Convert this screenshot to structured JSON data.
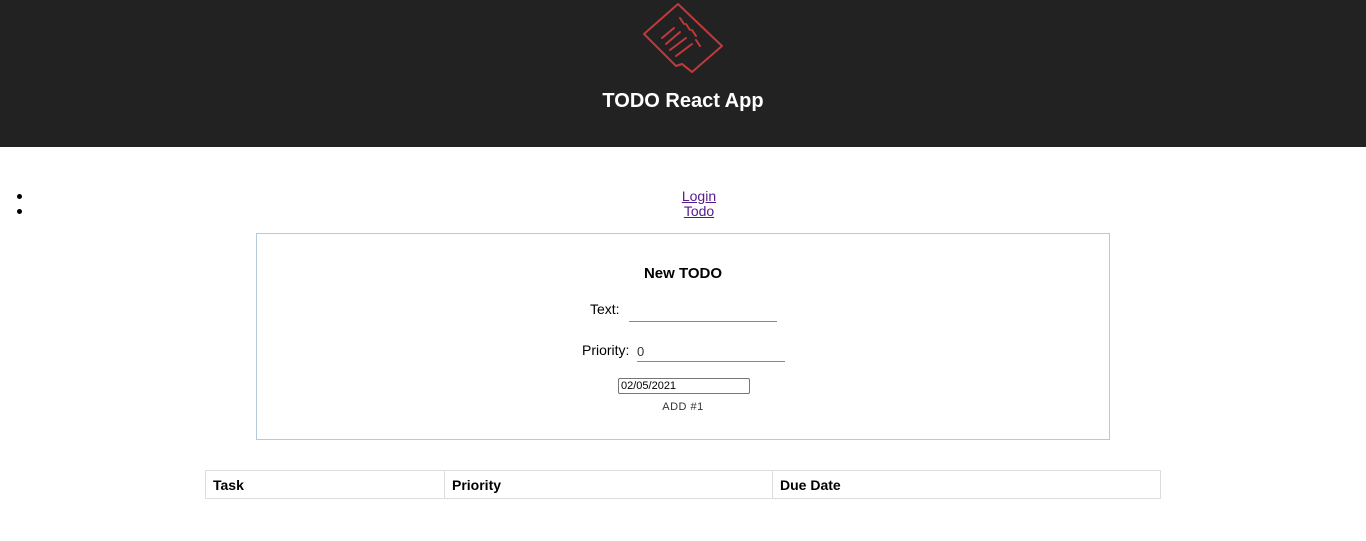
{
  "header": {
    "title": "TODO React App",
    "logo_icon": "todo-list-icon",
    "background": "#222222",
    "logo_color": "#c0393b"
  },
  "nav": {
    "items": [
      {
        "label": "Login"
      },
      {
        "label": "Todo"
      }
    ],
    "link_color": "#551a8b"
  },
  "form": {
    "title": "New TODO",
    "text_label": "Text:",
    "text_value": "",
    "priority_label": "Priority:",
    "priority_value": "0",
    "date_value": "02/05/2021",
    "add_button_label": "ADD #1",
    "border_color": "#b5c9d6"
  },
  "table": {
    "columns": [
      "Task",
      "Priority",
      "Due Date"
    ],
    "rows": []
  }
}
